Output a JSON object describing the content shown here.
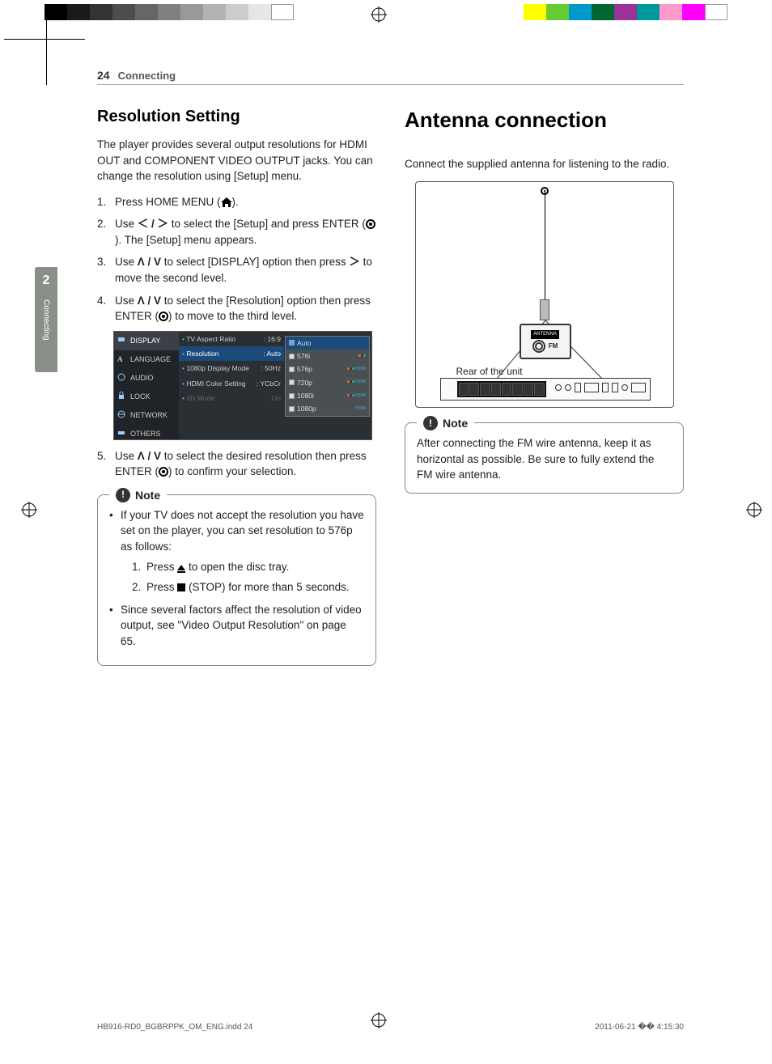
{
  "page_number": "24",
  "section": "Connecting",
  "side_tab": {
    "num": "2",
    "label": "Connecting"
  },
  "left": {
    "heading": "Resolution Setting",
    "intro": "The player provides several output resolutions for HDMI OUT and COMPONENT VIDEO OUTPUT jacks. You can change the resolution using [Setup] menu.",
    "step1_pre": "Press HOME MENU (",
    "step1_post": ").",
    "step2_pre": "Use ",
    "step2_arrows": "＜ / ＞",
    "step2_mid": " to select the [Setup] and press ENTER (",
    "step2_post": "). The [Setup] menu appears.",
    "step3_pre": "Use ",
    "step3_arrows": "Λ / V",
    "step3_mid": " to select [DISPLAY] option then press ",
    "step3_arrow2": "＞",
    "step3_post": " to move the second level.",
    "step4_pre": "Use ",
    "step4_arrows": "Λ / V",
    "step4_mid": " to select the [Resolution] option then press ENTER (",
    "step4_post": ") to move to the third level.",
    "step5_pre": "Use ",
    "step5_arrows": "Λ / V",
    "step5_mid": " to select the desired resolution then press ENTER (",
    "step5_post": ") to confirm your selection.",
    "screenshot": {
      "sidebar": [
        "DISPLAY",
        "LANGUAGE",
        "AUDIO",
        "LOCK",
        "NETWORK",
        "OTHERS"
      ],
      "main": [
        {
          "label": "TV Aspect Ratio",
          "val": ": 16:9"
        },
        {
          "label": "Resolution",
          "val": ": Auto",
          "sel": true
        },
        {
          "label": "1080p Display Mode",
          "val": ": 50Hz"
        },
        {
          "label": "HDMI Color Setting",
          "val": ": YCbCr"
        },
        {
          "label": "3D Mode",
          "val": ": On",
          "dim": true
        }
      ],
      "popup": [
        "Auto",
        "576i",
        "576p",
        "720p",
        "1080i",
        "1080p"
      ]
    },
    "note_title": "Note",
    "note_b1": "If your TV does not accept the resolution you have set on the player, you can set resolution to 576p as follows:",
    "note_b1_s1_pre": "Press ",
    "note_b1_s1_post": " to open the disc tray.",
    "note_b1_s2_pre": "Press ",
    "note_b1_s2_post": " (STOP) for more than 5 seconds.",
    "note_b2": "Since several factors affect the resolution of video output, see \"Video Output Resolution\" on page 65."
  },
  "right": {
    "heading": "Antenna connection",
    "intro": "Connect the supplied antenna for listening to the radio.",
    "fig": {
      "rear_label": "Rear of the unit",
      "antenna_label": "ANTENNA",
      "fm": "FM"
    },
    "note_title": "Note",
    "note_text": "After connecting the FM wire antenna, keep it as horizontal as possible. Be sure to fully extend the FM wire antenna."
  },
  "footer": {
    "file": "HB916-RD0_BGBRPPK_OM_ENG.indd   24",
    "date": "2011-06-21   �� 4:15:30"
  }
}
